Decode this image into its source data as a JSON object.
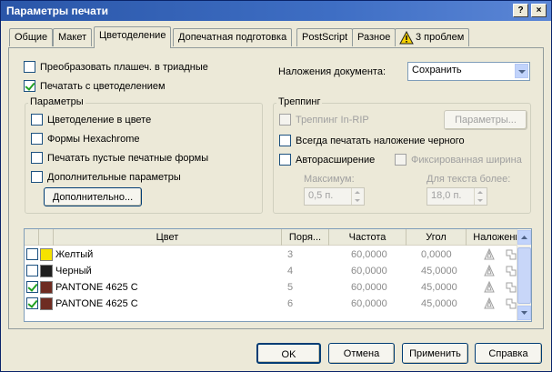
{
  "window": {
    "title": "Параметры печати",
    "controls": [
      "?",
      "×"
    ]
  },
  "tabs": [
    {
      "label": "Общие",
      "active": false
    },
    {
      "label": "Макет",
      "active": false
    },
    {
      "label": "Цветоделение",
      "active": true
    },
    {
      "label": "Допечатная подготовка",
      "active": false
    },
    {
      "label": "PostScript",
      "active": false
    },
    {
      "label": "Разное",
      "active": false
    },
    {
      "label": "3 проблем",
      "active": false
    }
  ],
  "top_options": {
    "convert_spot": {
      "label": "Преобразовать плашеч. в триадные",
      "checked": false
    },
    "print_separations": {
      "label": "Печатать с цветоделением",
      "checked": true
    },
    "overprint_label": "Наложения документа:",
    "overprint_value": "Сохранить"
  },
  "params_group": {
    "title": "Параметры",
    "items": [
      {
        "label": "Цветоделение в цвете",
        "checked": false
      },
      {
        "label": "Формы Hexachrome",
        "checked": false
      },
      {
        "label": "Печатать пустые печатные формы",
        "checked": false
      },
      {
        "label": "Дополнительные параметры",
        "checked": false
      }
    ],
    "advanced_button": "Дополнительно..."
  },
  "trapping_group": {
    "title": "Треппинг",
    "in_rip": {
      "label": "Треппинг In-RIP",
      "checked": false,
      "disabled": true
    },
    "params_button": "Параметры...",
    "always_overprint": {
      "label": "Всегда печатать наложение черного",
      "checked": false
    },
    "auto_spread": {
      "label": "Автораcширение",
      "checked": false
    },
    "fixed_width": {
      "label": "Фиксированная ширина",
      "checked": false,
      "disabled": true
    },
    "max_label": "Максимум:",
    "max_value": "0,5 п.",
    "text_above_label": "Для текста более:",
    "text_above_value": "18,0 п."
  },
  "table": {
    "columns": [
      "Цвет",
      "Поря...",
      "Частота",
      "Угол",
      "Наложение"
    ],
    "rows": [
      {
        "checked": false,
        "color": "#f5e200",
        "name": "Желтый",
        "order": "3",
        "frequency": "60,0000",
        "angle": "0,0000"
      },
      {
        "checked": false,
        "color": "#1e1e1e",
        "name": "Черный",
        "order": "4",
        "frequency": "60,0000",
        "angle": "45,0000"
      },
      {
        "checked": true,
        "color": "#6e2c22",
        "name": "PANTONE 4625 C",
        "order": "5",
        "frequency": "60,0000",
        "angle": "45,0000"
      },
      {
        "checked": true,
        "color": "#6e2c22",
        "name": "PANTONE 4625 C",
        "order": "6",
        "frequency": "60,0000",
        "angle": "45,0000"
      }
    ]
  },
  "footer": {
    "ok": "OK",
    "cancel": "Отмена",
    "apply": "Применить",
    "help": "Справка"
  },
  "colors": {
    "title_bar": "#2a56a8",
    "dialog_bg": "#ece9d8",
    "warning": "#f5d000"
  },
  "icons": {
    "warning_tab": "warning-triangle-icon",
    "overprint_fill": "overprint-fill-icon",
    "overprint_stroke": "overprint-stroke-icon"
  }
}
